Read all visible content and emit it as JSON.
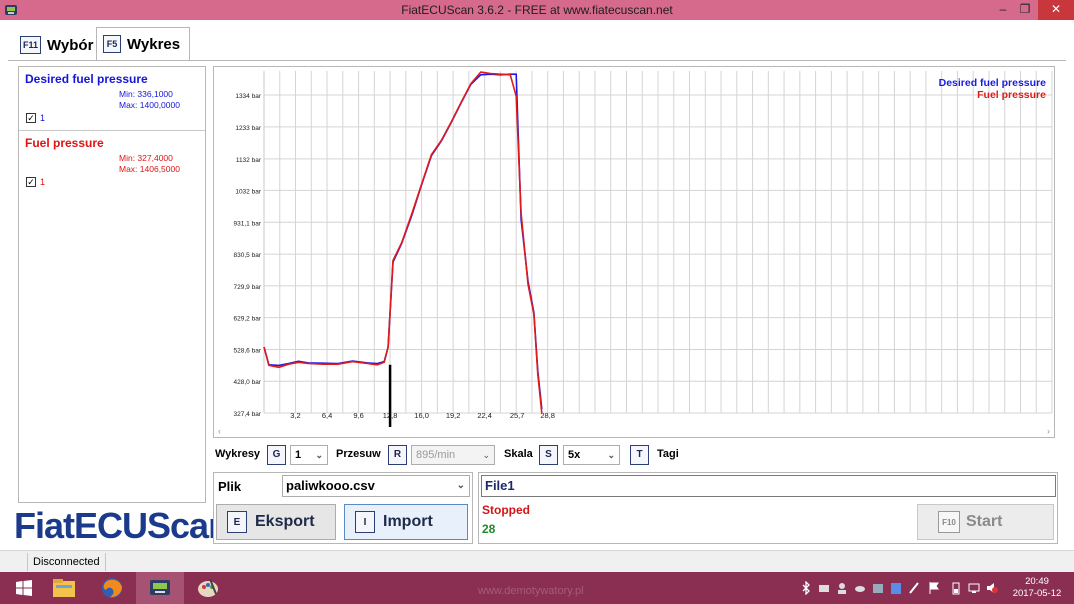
{
  "window": {
    "title": "FiatECUScan 3.6.2 - FREE at www.fiatecuscan.net",
    "minimize_glyph": "–",
    "restore_glyph": "❐",
    "close_glyph": "✕"
  },
  "tabs": [
    {
      "key": "F11",
      "label": "Wybór",
      "active": false
    },
    {
      "key": "F5",
      "label": "Wykres",
      "active": true
    }
  ],
  "sensors": [
    {
      "name": "Desired fuel pressure",
      "min": "Min: 336,1000",
      "max": "Max: 1400,0000",
      "checked": true,
      "check_label": "1",
      "color": "#1010e0"
    },
    {
      "name": "Fuel pressure",
      "min": "Min: 327,4000",
      "max": "Max: 1406,5000",
      "checked": true,
      "check_label": "1",
      "color": "#e01010"
    }
  ],
  "logo": "FiatECUScan",
  "chart_data": {
    "type": "line",
    "y_ticks": [
      "327,4 bar",
      "428,0 bar",
      "528,6 bar",
      "629,2 bar",
      "729,9 bar",
      "830,5 bar",
      "931,1 bar",
      "1032 bar",
      "1132 bar",
      "1233 bar",
      "1334 bar"
    ],
    "y_tick_values": [
      327.4,
      428.0,
      528.6,
      629.2,
      729.9,
      830.5,
      931.1,
      1032,
      1132,
      1233,
      1334
    ],
    "x_ticks": [
      "3,2",
      "6,4",
      "9,6",
      "12,8",
      "16,0",
      "19,2",
      "22,4",
      "25,7",
      "28,8"
    ],
    "x_tick_values": [
      3.2,
      6.4,
      9.6,
      12.8,
      16.0,
      19.2,
      22.4,
      25.7,
      28.8
    ],
    "xlim": [
      0,
      80
    ],
    "ylim": [
      327.4,
      1410
    ],
    "legend_position": "top-right",
    "series": [
      {
        "name": "Desired fuel pressure",
        "color": "#1a1ae6",
        "x": [
          0,
          0.5,
          1.5,
          2.5,
          3.5,
          4.5,
          6,
          7.5,
          9,
          10.5,
          11.5,
          12.2,
          12.6,
          13.1,
          14,
          15,
          16,
          17,
          18,
          19,
          20,
          21,
          22,
          23,
          24,
          25,
          25.6,
          26.1,
          26.8,
          27.4,
          27.8,
          28.2
        ],
        "y": [
          536,
          480,
          478,
          484,
          491,
          486,
          485,
          484,
          492,
          486,
          484,
          490,
          536,
          805,
          866,
          953,
          1050,
          1142,
          1188,
          1246,
          1308,
          1368,
          1398,
          1400,
          1398,
          1400,
          1400,
          940,
          745,
          645,
          460,
          340
        ]
      },
      {
        "name": "Fuel pressure",
        "color": "#e01a1a",
        "x": [
          0,
          0.5,
          1.5,
          2.5,
          3.5,
          4.5,
          6,
          7.5,
          9,
          10.5,
          11.5,
          12.2,
          12.6,
          13.1,
          14,
          15,
          16,
          17,
          18,
          19,
          20,
          21,
          22,
          23,
          24,
          25,
          25.6,
          26.1,
          26.8,
          27.4,
          27.8,
          28.2
        ],
        "y": [
          536,
          478,
          472,
          482,
          488,
          484,
          482,
          482,
          490,
          484,
          480,
          488,
          536,
          810,
          868,
          958,
          1052,
          1145,
          1190,
          1248,
          1310,
          1370,
          1406.5,
          1402,
          1400,
          1398,
          1330,
          960,
          735,
          640,
          450,
          327.4
        ]
      }
    ]
  },
  "controls": {
    "wykresy_label": "Wykresy",
    "wykresy_key": "G",
    "wykresy_value": "1",
    "przesuw_label": "Przesuw",
    "przesuw_key": "R",
    "przesuw_value": "895/min",
    "skala_label": "Skala",
    "skala_key": "S",
    "skala_value": "5x",
    "tagi_key": "T",
    "tagi_label": "Tagi",
    "caret": "⌄"
  },
  "file": {
    "label": "Plik",
    "selected": "paliwkooo.csv",
    "export_key": "E",
    "export_label": "Eksport",
    "import_key": "I",
    "import_label": "Import"
  },
  "status": {
    "file_name": "File1",
    "state": "Stopped",
    "count": "28",
    "start_key": "F10",
    "start_label": "Start"
  },
  "statusbar": {
    "connection": "Disconnected"
  },
  "taskbar": {
    "watermark": "www.demotywatory.pl",
    "time": "20:49",
    "date": "2017-05-12"
  }
}
